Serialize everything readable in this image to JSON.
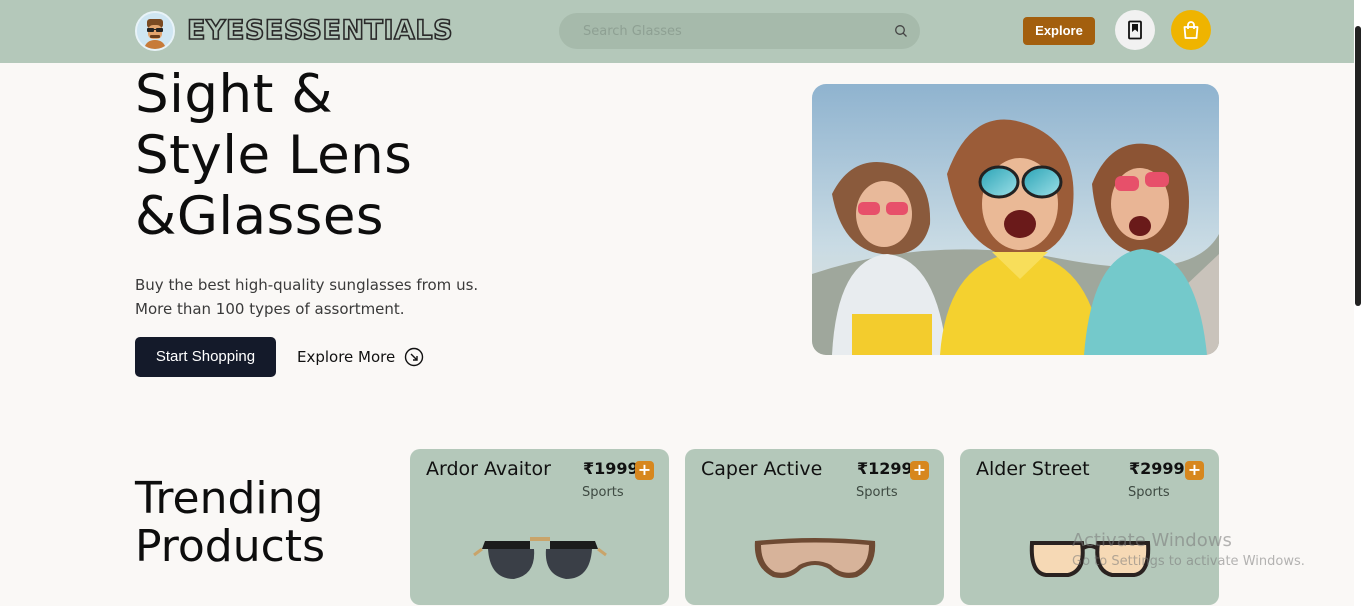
{
  "header": {
    "brand": "EYESESSENTIALS",
    "search_placeholder": "Search Glasses",
    "explore_label": "Explore"
  },
  "hero": {
    "title_lines": [
      "Sight &",
      "Style Lens",
      "&Glasses"
    ],
    "desc_lines": [
      "Buy the best high-quality sunglasses from us.",
      "More than 100 types of assortment."
    ],
    "start_label": "Start Shopping",
    "explore_more_label": "Explore More"
  },
  "trending": {
    "title_lines": [
      "Trending",
      "Products"
    ],
    "products": [
      {
        "name": "Ardor Avaitor",
        "price": "₹1999",
        "category": "Sports"
      },
      {
        "name": "Caper Active",
        "price": "₹1299",
        "category": "Sports"
      },
      {
        "name": "Alder Street",
        "price": "₹2999",
        "category": "Sports"
      }
    ]
  },
  "watermark": {
    "line1": "Activate Windows",
    "line2": "Go to Settings to activate Windows."
  },
  "colors": {
    "header_bg": "#b4c8ba",
    "explore_btn": "#a35f0e",
    "cart_btn": "#efb400",
    "start_btn": "#141a2a",
    "card_bg": "#b4c8ba"
  },
  "icons": [
    "avatar-icon",
    "search-icon",
    "bookmark-icon",
    "shopping-bag-icon",
    "arrow-circle-icon",
    "plus-icon"
  ]
}
